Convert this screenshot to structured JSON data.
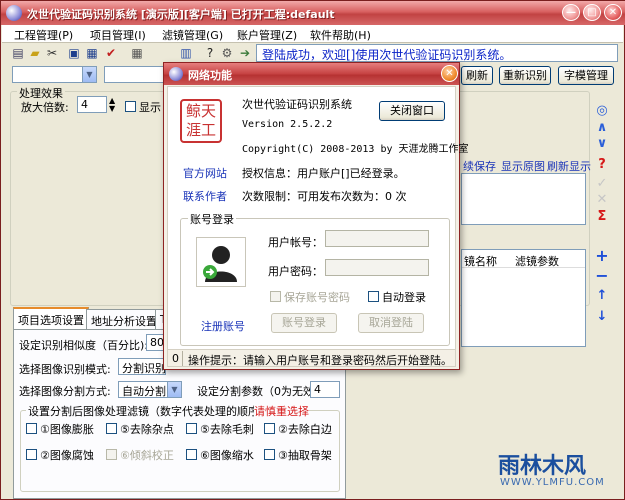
{
  "window": {
    "title": "次世代验证码识别系统 [演示版][客户端] 已打开工程:default"
  },
  "menu": [
    "工程管理(P)",
    "项目管理(I)",
    "滤镜管理(G)",
    "账户管理(Z)",
    "软件帮助(H)"
  ],
  "toolbar_icons": [
    "new-icon",
    "open-icon",
    "cut-icon",
    "save-icon",
    "save-all-icon",
    "check-icon",
    "grid-icon",
    "bars-icon",
    "help-cursor-icon",
    "settings-icon",
    "export-icon"
  ],
  "login_message": "登陆成功，欢迎[]使用次世代验证码识别系统。",
  "top_buttons": {
    "refresh": "刷新",
    "recognize": "重新识别",
    "font": "字模管理"
  },
  "process_effect": {
    "group_label": "处理效果",
    "zoom_label": "放大倍数:",
    "zoom_value": "4",
    "show_label": "显示"
  },
  "right_links": [
    "续保存",
    "显示原图",
    "刷新显示"
  ],
  "filter_table": {
    "headers": [
      "镜名称",
      "滤镜参数"
    ]
  },
  "tabs": [
    "项目选项设置",
    "地址分析设置",
    "T"
  ],
  "project_settings": {
    "similarity_label": "设定识别相似度（百分比):",
    "similarity_value": "80",
    "mode_label": "选择图像识别模式:",
    "mode_value": "分割识别",
    "split_label": "选择图像分割方式:",
    "split_value": "自动分割",
    "split_param_label": "设定分割参数（0为无效)",
    "split_param_value": "4",
    "filter_group_label": "设置分割后图像处理滤镜（数字代表处理的顺序）",
    "filter_choose": "请慎重选择",
    "filters": [
      "①图像膨胀",
      "⑤去除杂点",
      "⑤去除毛刺",
      "②去除白边",
      "②图像腐蚀",
      "⑥倾斜校正",
      "⑥图像缩水",
      "③抽取骨架"
    ]
  },
  "dialog": {
    "title": "网络功能",
    "logo_text": [
      "鲸",
      "天",
      "涯",
      "工"
    ],
    "product_name": "次世代验证码识别系统",
    "version": "Version 2.5.2.2",
    "copyright": "Copyright(C) 2008-2013 by 天涯龙腾工作室",
    "close_button": "关闭窗口",
    "website_link": "官方网站",
    "contact_link": "联系作者",
    "auth_info": "授权信息：用户账户[]已经登录。",
    "usage_limit": "次数限制：可用发布次数为：0 次",
    "login_group": "账号登录",
    "username_label": "用户帐号：",
    "password_label": "用户密码：",
    "save_password": "保存账号密码",
    "auto_login": "自动登录",
    "register_link": "注册账号",
    "login_button": "账号登录",
    "cancel_button": "取消登陆",
    "status_num": "0",
    "status_text": "操作提示：请输入用户账号和登录密码然后开始登陆。"
  },
  "watermark": {
    "text": "雨林木风",
    "url": "WWW.YLMFU.COM"
  }
}
